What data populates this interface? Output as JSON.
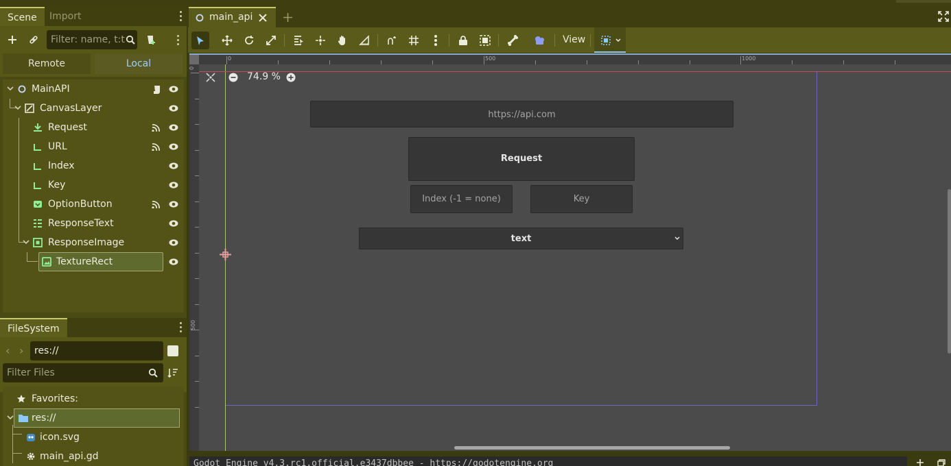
{
  "scene_dock": {
    "tabs": [
      "Scene",
      "Import"
    ],
    "filter_placeholder": "Filter: name, t:t",
    "remote_label": "Remote",
    "local_label": "Local",
    "nodes": [
      {
        "label": "MainAPI",
        "icon": "node-circle-icon"
      },
      {
        "label": "CanvasLayer",
        "icon": "canvas-layer-icon"
      },
      {
        "label": "Request",
        "icon": "http-request-icon"
      },
      {
        "label": "URL",
        "icon": "line-edit-icon"
      },
      {
        "label": "Index",
        "icon": "line-edit-icon"
      },
      {
        "label": "Key",
        "icon": "line-edit-icon"
      },
      {
        "label": "OptionButton",
        "icon": "option-button-icon"
      },
      {
        "label": "ResponseText",
        "icon": "text-edit-icon"
      },
      {
        "label": "ResponseImage",
        "icon": "center-container-icon"
      },
      {
        "label": "TextureRect",
        "icon": "texture-rect-icon"
      }
    ]
  },
  "filesystem": {
    "tab": "FileSystem",
    "path": "res://",
    "filter_placeholder": "Filter Files",
    "items": [
      {
        "label": "Favorites:",
        "icon": "star-icon"
      },
      {
        "label": "res://",
        "icon": "folder-icon"
      },
      {
        "label": "icon.svg",
        "icon": "godot-icon"
      },
      {
        "label": "main_api.gd",
        "icon": "gear-icon"
      }
    ]
  },
  "editor": {
    "tab_label": "main_api",
    "view_menu": "View",
    "zoom": "74.9 %",
    "ruler_top": [
      "0",
      "500",
      "1000"
    ],
    "ruler_left": [
      "0",
      "500"
    ]
  },
  "canvas": {
    "url_placeholder": "https://api.com",
    "request_label": "Request",
    "index_placeholder": "Index (-1 = none)",
    "key_placeholder": "Key",
    "option_value": "text"
  },
  "status": {
    "console_text": "Godot Engine v4.3.rc1.official.e3437dbbee - https://godotengine.org"
  },
  "colors": {
    "accent": "#c8c870",
    "node_green": "#8eef97",
    "dock_bg": "#4a4a14",
    "viewport_bg": "#4b4b4b"
  }
}
